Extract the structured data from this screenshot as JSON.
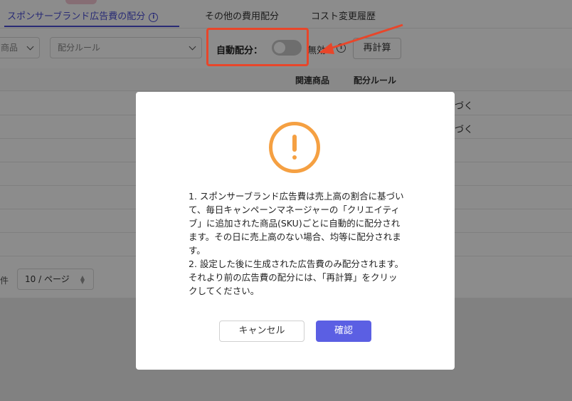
{
  "tabs": [
    {
      "label": "スポンサーブランド広告費の配分"
    },
    {
      "label": "その他の費用配分"
    },
    {
      "label": "コスト変更履歴"
    }
  ],
  "toolbar": {
    "product_select": "商品",
    "rule_select_placeholder": "配分ルール",
    "auto_allocation_label": "自動配分：",
    "toggle_state": "無効",
    "recalculate_button": "再計算"
  },
  "table": {
    "headers": [
      "関連商品",
      "配分ルール"
    ],
    "rows": [
      {
        "rule": "づく"
      },
      {
        "rule": "づく"
      },
      {
        "rule": ""
      },
      {
        "rule": ""
      },
      {
        "rule": ""
      },
      {
        "rule": ""
      },
      {
        "rule": ""
      }
    ]
  },
  "pagination": {
    "total_suffix": "件",
    "page_size": "10 / ページ"
  },
  "modal": {
    "lines": [
      "1. スポンサーブランド広告費は売上高の割合に基づいて、毎日キャンペーンマネージャーの「クリエイティブ」に追加された商品(SKU)ごとに自動的に配分されます。その日に売上高のない場合、均等に配分されます。",
      "2. 設定した後に生成された広告費のみ配分されます。それより前の広告費の配分には、「再計算」をクリックしてください。"
    ],
    "cancel_button": "キャンセル",
    "confirm_button": "確認"
  },
  "colors": {
    "accent": "#4b4fd6",
    "confirm": "#5b5fe3",
    "warning": "#f5a042",
    "highlight": "#e8462a"
  }
}
